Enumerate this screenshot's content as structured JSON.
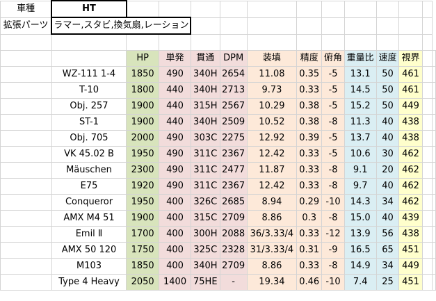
{
  "top": {
    "vehicle_type_label": "車種",
    "vehicle_type_value": "HT",
    "extension_parts_label": "拡張パーツ",
    "extension_parts_value": "ラマー,スタビ,換気扇,レーション"
  },
  "table": {
    "headers": [
      "",
      "HP",
      "単発",
      "貫通",
      "DPM",
      "装填",
      "精度",
      "俯角",
      "重量比",
      "速度",
      "視界"
    ],
    "rows": [
      [
        "WZ-111 1-4",
        "1850",
        "490",
        "340H",
        "2654",
        "11.08",
        "0.35",
        "-5",
        "13.1",
        "50",
        "461"
      ],
      [
        "T-10",
        "1800",
        "440",
        "340H",
        "2713",
        "9.73",
        "0.33",
        "-5",
        "14.5",
        "50",
        "461"
      ],
      [
        "Obj. 257",
        "1900",
        "440",
        "315H",
        "2567",
        "10.29",
        "0.38",
        "-5",
        "15.2",
        "50",
        "449"
      ],
      [
        "ST-1",
        "1900",
        "440",
        "340H",
        "2509",
        "10.52",
        "0.38",
        "-8",
        "11.3",
        "40",
        "438"
      ],
      [
        "Obj. 705",
        "2000",
        "490",
        "303C",
        "2275",
        "12.92",
        "0.39",
        "-5",
        "13.7",
        "40",
        "438"
      ],
      [
        "VK 45.02 B",
        "1950",
        "490",
        "311C",
        "2367",
        "12.42",
        "0.33",
        "-5",
        "10.6",
        "30",
        "462"
      ],
      [
        "Mäuschen",
        "2300",
        "490",
        "311C",
        "2477",
        "11.87",
        "0.33",
        "-8",
        "9.1",
        "20",
        "462"
      ],
      [
        "E75",
        "1920",
        "490",
        "311C",
        "2367",
        "12.42",
        "0.33",
        "-8",
        "9.7",
        "40",
        "462"
      ],
      [
        "Conqueror",
        "1950",
        "400",
        "326C",
        "2685",
        "8.94",
        "0.29",
        "-10",
        "14.3",
        "34",
        "462"
      ],
      [
        "AMX M4 51",
        "1900",
        "400",
        "315C",
        "2709",
        "8.86",
        "0.3",
        "-8",
        "15.0",
        "40",
        "439"
      ],
      [
        "Emil Ⅱ",
        "1700",
        "400",
        "300H",
        "2088",
        "36/3.33/4",
        "0.33",
        "-12",
        "13.9",
        "56",
        "438"
      ],
      [
        "AMX 50 120",
        "1750",
        "400",
        "325C",
        "2328",
        "31/3.33/4",
        "0.31",
        "-9",
        "16.5",
        "65",
        "451"
      ],
      [
        "M103",
        "1850",
        "400",
        "340H",
        "2709",
        "8.86",
        "0.33",
        "-8",
        "14.9",
        "34",
        "449"
      ],
      [
        "Type 4 Heavy",
        "2050",
        "1400",
        "75HE",
        "-",
        "19.34",
        "0.46",
        "-10",
        "7.4",
        "25",
        "451"
      ]
    ]
  },
  "colors": {
    "hp": "#d8e4bc",
    "damage_pen_dpm": "#f2dcdb",
    "reload_acc_depression": "#fde9d9",
    "weight_speed": "#daeef3",
    "view_range": "#ffffcc",
    "gridline": "#d4d4d4"
  }
}
